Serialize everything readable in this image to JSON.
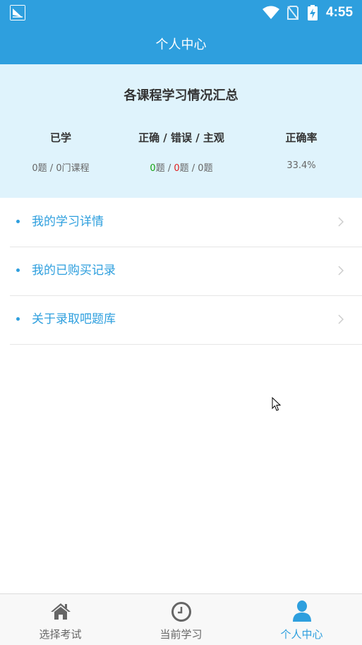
{
  "status_bar": {
    "time": "4:55",
    "icons": [
      "app-icon",
      "wifi-icon",
      "no-sim-icon",
      "battery-charging-icon"
    ]
  },
  "app_bar": {
    "title": "个人中心"
  },
  "summary": {
    "title": "各课程学习情况汇总",
    "columns": [
      {
        "label": "已学",
        "value": "0题 / 0门课程"
      },
      {
        "label": "正确 / 错误 / 主观",
        "correct": "0",
        "correct_unit": "题 / ",
        "wrong": "0",
        "wrong_unit": "题 / ",
        "subjective": "0题"
      },
      {
        "label": "正确率",
        "value": "33.4%"
      }
    ]
  },
  "menu": {
    "items": [
      {
        "label": "我的学习详情"
      },
      {
        "label": "我的已购买记录"
      },
      {
        "label": "关于录取吧题库"
      }
    ]
  },
  "bottom_nav": {
    "items": [
      {
        "label": "选择考试",
        "icon": "home-icon"
      },
      {
        "label": "当前学习",
        "icon": "clock-icon"
      },
      {
        "label": "个人中心",
        "icon": "user-icon",
        "active": true
      }
    ]
  },
  "colors": {
    "primary": "#2e9fde",
    "summary_bg": "#dff3fc",
    "correct": "#16a316",
    "wrong": "#e02020"
  }
}
